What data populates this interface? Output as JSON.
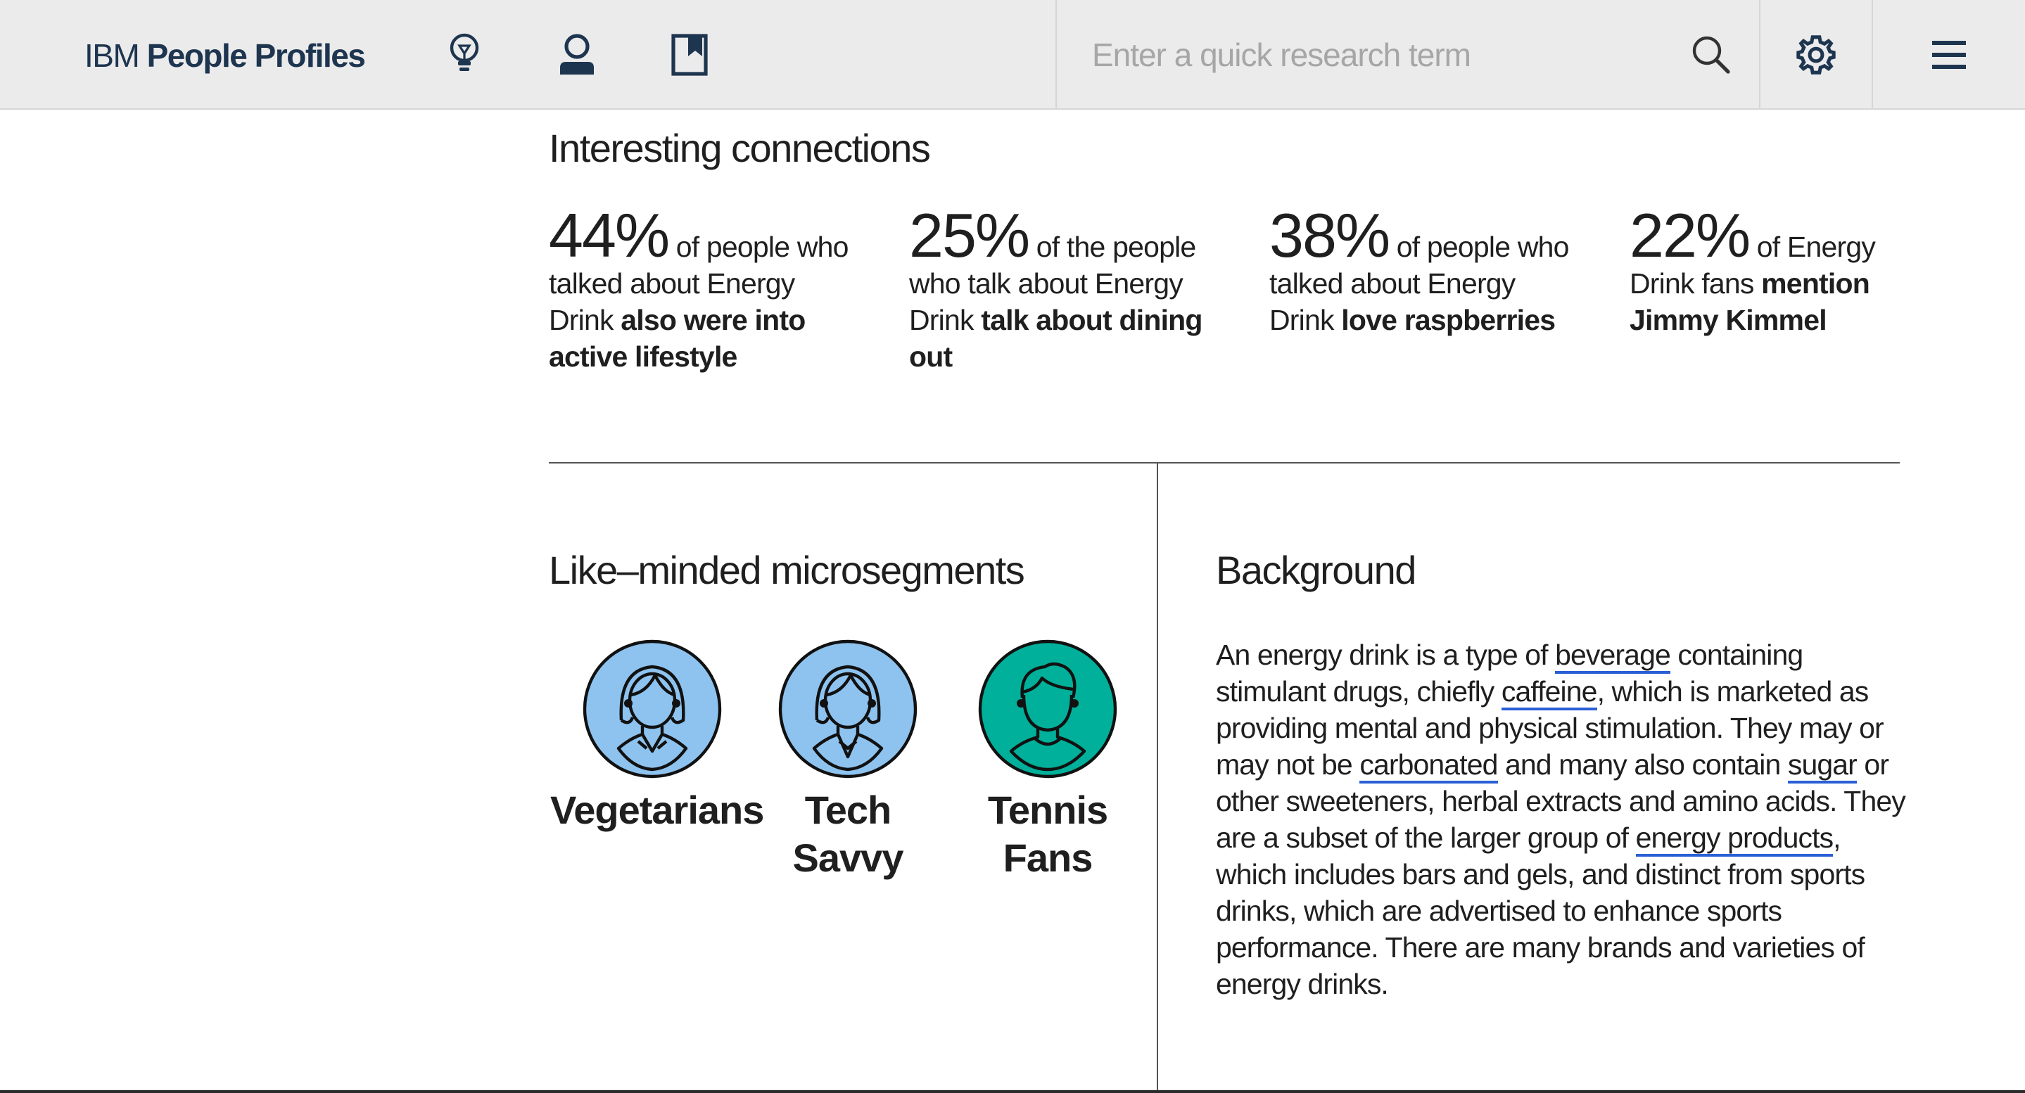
{
  "header": {
    "brand_light": "IBM",
    "brand_bold": "People Profiles",
    "nav_icons": [
      "lightbulb-icon",
      "user-icon",
      "bookmark-icon"
    ],
    "search_placeholder": "Enter a quick research term",
    "search_value": "",
    "search_icon": "search-icon",
    "settings_icon": "gear-icon",
    "menu_icon": "hamburger-menu-icon"
  },
  "connections": {
    "title": "Interesting connections",
    "stats": [
      {
        "pct": "44%",
        "pre": " of people who talked about Energy Drink ",
        "bold": "also were into active lifestyle"
      },
      {
        "pct": "25%",
        "pre": " of the people who talk about Energy Drink ",
        "bold": "talk about dining out"
      },
      {
        "pct": "38%",
        "pre": " of people who talked about Energy Drink ",
        "bold": "love raspberries"
      },
      {
        "pct": "22%",
        "pre": " of Energy Drink fans ",
        "bold": "mention Jimmy Kimmel"
      }
    ]
  },
  "microsegments": {
    "title": "Like–minded microsegments",
    "items": [
      {
        "label": "Vegetarians",
        "color": "#8ec3ef",
        "icon": "woman-avatar-icon"
      },
      {
        "label": "Tech Savvy",
        "color": "#8ec3ef",
        "icon": "woman-avatar-icon"
      },
      {
        "label": "Tennis Fans",
        "color": "#00b09a",
        "icon": "man-avatar-icon"
      }
    ]
  },
  "background": {
    "title": "Background",
    "t1": "An energy drink is a type of ",
    "link1": "beverage",
    "t2": " containing stimulant drugs, chiefly ",
    "link2": "caffeine",
    "t3": ", which is marketed as providing mental and physical stimulation. They may or may not be ",
    "link3": "carbonated",
    "t4": " and many also contain ",
    "link4": "sugar",
    "t5": " or other sweeteners, herbal extracts and amino acids. They are a subset of the larger group of ",
    "link5": "energy products",
    "t6": ", which includes bars and gels, and distinct from sports drinks, which are advertised to enhance sports performance. There are many brands and varieties of energy drinks."
  },
  "colors": {
    "brand": "#1e3550",
    "header_bg": "#ebebeb",
    "link_underline": "#2a5fd6",
    "avatar_blue": "#8ec3ef",
    "avatar_teal": "#00b09a"
  }
}
